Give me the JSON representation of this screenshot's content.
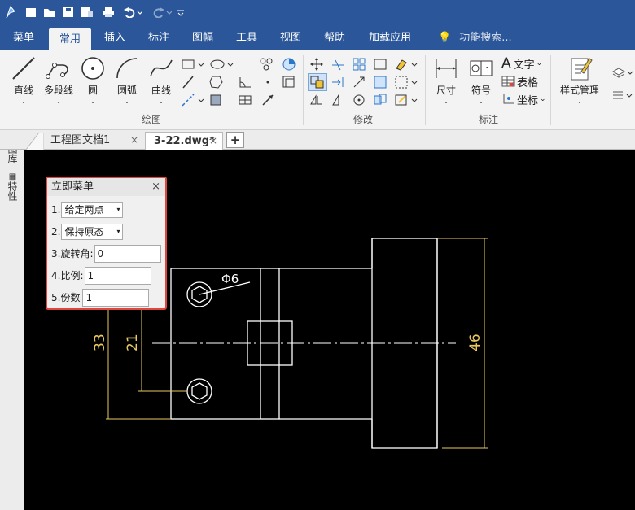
{
  "quickaccess": {
    "app": "app-logo-icon",
    "items": [
      "new-icon",
      "open-icon",
      "save-icon",
      "save-as-icon",
      "print-icon",
      "undo-icon",
      "redo-icon",
      "customize-icon"
    ]
  },
  "menubar": {
    "tabs": [
      "菜单",
      "常用",
      "插入",
      "标注",
      "图幅",
      "工具",
      "视图",
      "帮助",
      "加载应用"
    ],
    "active": "常用",
    "search": "功能搜索..."
  },
  "ribbon": {
    "draw": {
      "line": "直线",
      "polyline": "多段线",
      "circle": "圆",
      "arc": "圆弧",
      "curve": "曲线",
      "group": "绘图"
    },
    "modify": {
      "group": "修改"
    },
    "dim": {
      "size": "尺寸",
      "symbol": "符号",
      "text": "文字",
      "table": "表格",
      "coord": "坐标",
      "group": "标注"
    },
    "style": {
      "manage": "样式管理"
    }
  },
  "doctabs": {
    "tab1": "工程图文档1",
    "tab2": "3-22.dwg*",
    "add": "+"
  },
  "sidebar": {
    "tab1": "图库",
    "tab2": "特性"
  },
  "panel": {
    "title": "立即菜单",
    "row1_label": "1.",
    "row1_value": "给定两点",
    "row2_label": "2.",
    "row2_value": "保持原态",
    "row3_label": "3.旋转角:",
    "row3_value": "0",
    "row4_label": "4.比例:",
    "row4_value": "1",
    "row5_label": "5.份数",
    "row5_value": "1"
  },
  "drawing": {
    "dim_33": "33",
    "dim_21": "21",
    "dim_46": "46",
    "dim_phi6": "Φ6"
  },
  "colors": {
    "accent": "#2b579a",
    "dimension": "#e8c860",
    "outline": "#ffffff",
    "panel_border": "#e0463c"
  }
}
